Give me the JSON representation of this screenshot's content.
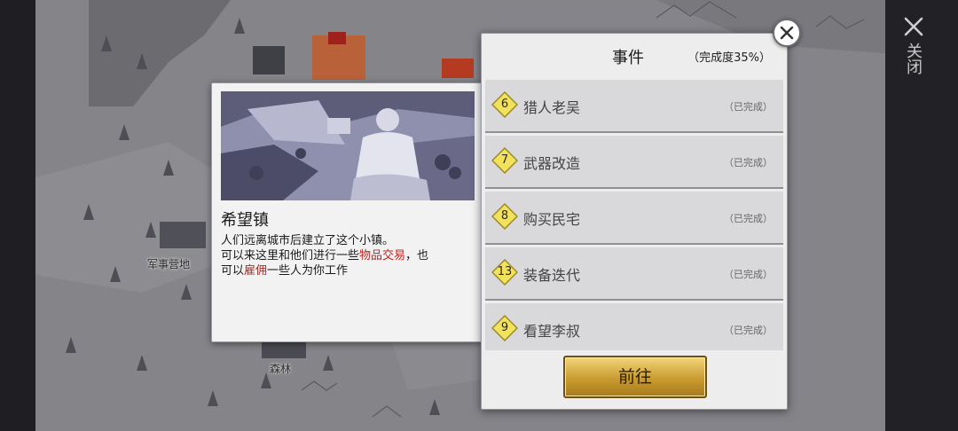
{
  "side_panel": {
    "close_label": "关闭"
  },
  "map": {
    "labels": [
      "军事营地",
      "森林"
    ]
  },
  "info_card": {
    "title": "希望镇",
    "desc_line1": "人们远离城市后建立了这个小镇。",
    "desc_line2_a": "可以来这里和他们进行一些",
    "desc_line2_kw": "物品交易",
    "desc_line2_b": "，也",
    "desc_line3_a": "可以",
    "desc_line3_kw": "雇佣",
    "desc_line3_b": "一些人为你工作"
  },
  "events_panel": {
    "title": "事件",
    "progress": "（完成度35%）",
    "events": [
      {
        "num": "6",
        "name": "猎人老吴",
        "status": "（已完成）"
      },
      {
        "num": "7",
        "name": "武器改造",
        "status": "（已完成）"
      },
      {
        "num": "8",
        "name": "购买民宅",
        "status": "（已完成）"
      },
      {
        "num": "13",
        "name": "装备迭代",
        "status": "（已完成）"
      },
      {
        "num": "9",
        "name": "看望李叔",
        "status": "（已完成）"
      }
    ],
    "go_label": "前往"
  },
  "colors": {
    "badge_yellow": "#f2e15a",
    "keyword_red": "#c0241f",
    "gold_button": "#c99b2f"
  }
}
